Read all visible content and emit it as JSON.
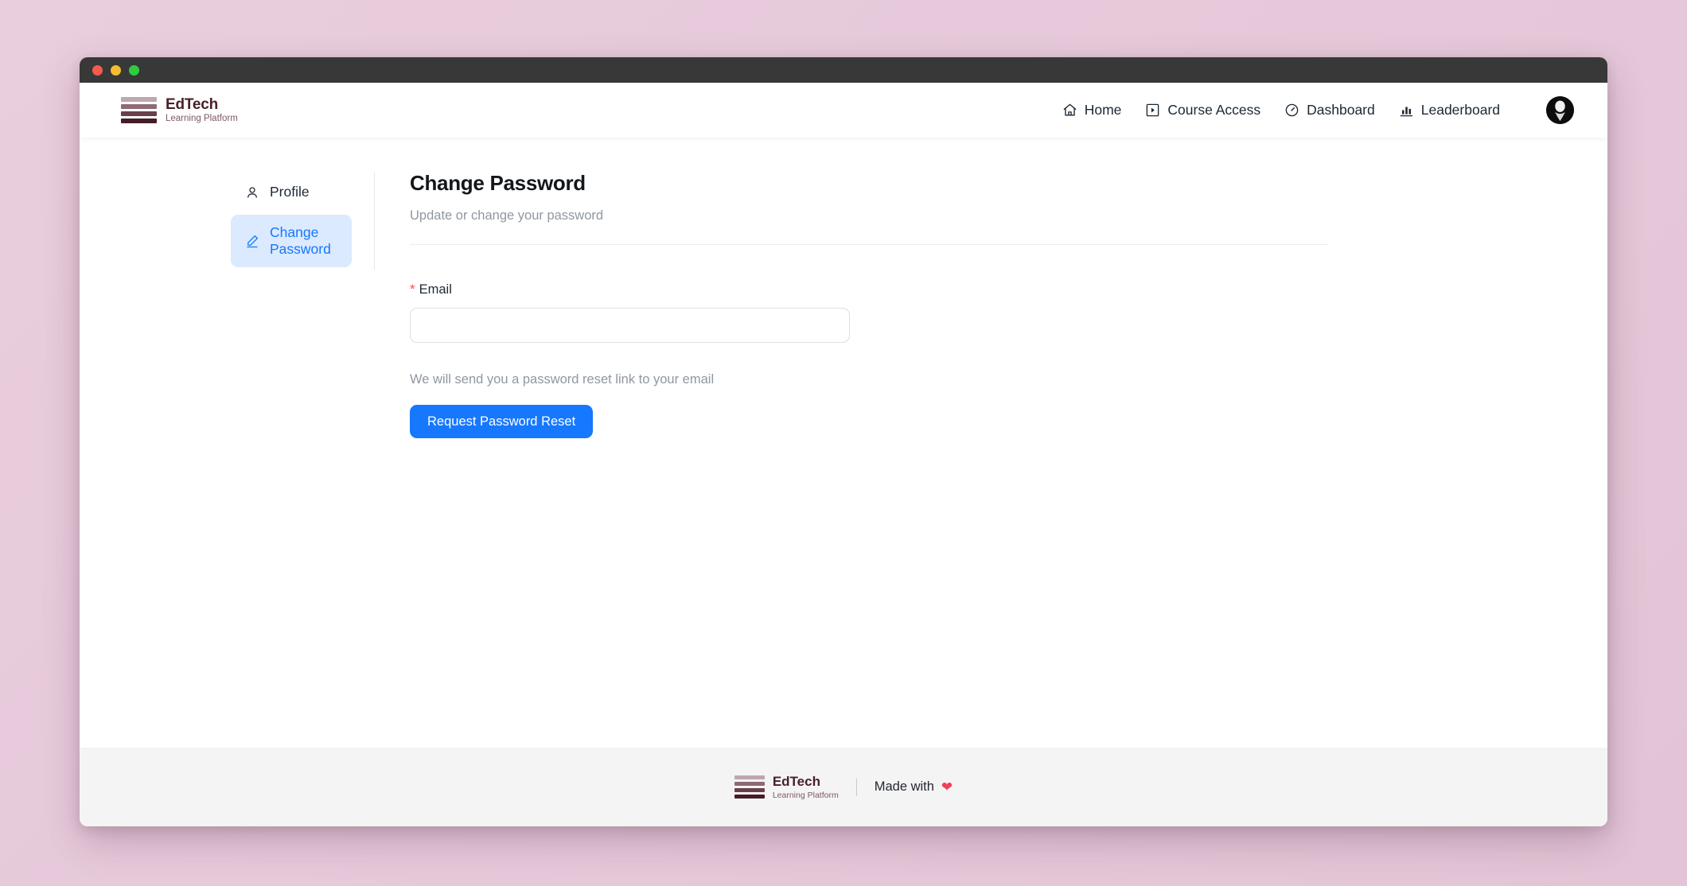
{
  "window": {
    "traffic_lights": [
      "close",
      "minimize",
      "maximize"
    ]
  },
  "header": {
    "brand": {
      "title": "EdTech",
      "subtitle": "Learning Platform",
      "bar_colors": [
        "#bda7b0",
        "#8e6a75",
        "#68404b",
        "#451d27"
      ]
    },
    "nav": [
      {
        "label": "Home",
        "icon": "home-icon"
      },
      {
        "label": "Course Access",
        "icon": "play-square-icon"
      },
      {
        "label": "Dashboard",
        "icon": "gauge-icon"
      },
      {
        "label": "Leaderboard",
        "icon": "bar-chart-icon"
      }
    ],
    "avatar": {
      "icon": "user-avatar"
    }
  },
  "sidebar": {
    "items": [
      {
        "label": "Profile",
        "icon": "user-icon",
        "active": false
      },
      {
        "label": "Change Password",
        "icon": "pencil-edit-icon",
        "active": true
      }
    ]
  },
  "main": {
    "title": "Change Password",
    "subtitle": "Update or change your password",
    "form": {
      "email": {
        "label": "Email",
        "required_marker": "*",
        "value": "",
        "placeholder": ""
      },
      "helper_text": "We will send you a password reset link to your email",
      "submit_label": "Request Password Reset"
    }
  },
  "footer": {
    "brand": {
      "title": "EdTech",
      "subtitle": "Learning Platform"
    },
    "made_with_text": "Made with",
    "heart": "❤"
  },
  "colors": {
    "accent_blue": "#1677ff",
    "active_bg": "#dbeafe",
    "brand_dark": "#451d27",
    "required_red": "#ff4d4f",
    "heart_red": "#ef4056",
    "page_bg": "#e6cadb"
  }
}
